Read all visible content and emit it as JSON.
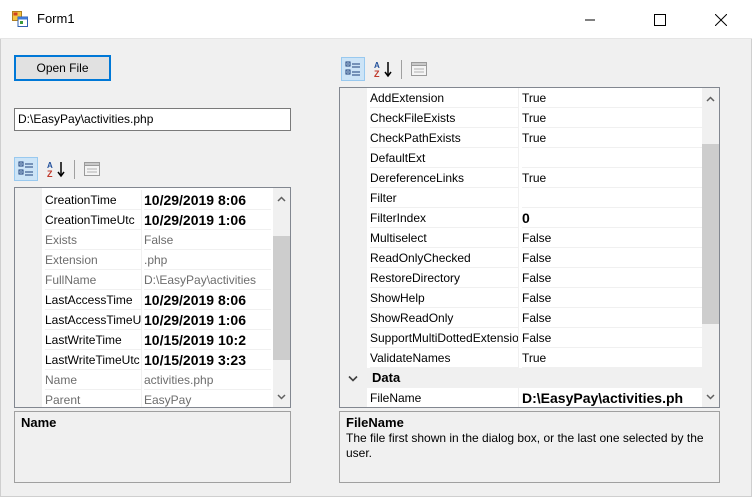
{
  "window": {
    "title": "Form1"
  },
  "open_button": {
    "label": "Open File"
  },
  "path_input": {
    "value": "D:\\EasyPay\\activities.php"
  },
  "left_grid": {
    "rows": [
      {
        "name": "CreationTime",
        "value": "10/29/2019 8:06",
        "style": "bigbold"
      },
      {
        "name": "CreationTimeUtc",
        "value": "10/29/2019 1:06",
        "style": "bigbold"
      },
      {
        "name": "Exists",
        "value": "False",
        "style": "ro"
      },
      {
        "name": "Extension",
        "value": ".php",
        "style": "ro"
      },
      {
        "name": "FullName",
        "value": "D:\\EasyPay\\activities",
        "style": "ro"
      },
      {
        "name": "LastAccessTime",
        "value": "10/29/2019 8:06",
        "style": "bigbold"
      },
      {
        "name": "LastAccessTimeUtc",
        "value": "10/29/2019 1:06",
        "style": "bigbold"
      },
      {
        "name": "LastWriteTime",
        "value": "10/15/2019 10:2",
        "style": "bigbold"
      },
      {
        "name": "LastWriteTimeUtc",
        "value": "10/15/2019 3:23",
        "style": "bigbold"
      },
      {
        "name": "Name",
        "value": "activities.php",
        "style": "ro"
      },
      {
        "name": "Parent",
        "value": "EasyPay",
        "style": "ro"
      }
    ],
    "help_title": "Name",
    "help_desc": ""
  },
  "right_grid": {
    "rows": [
      {
        "name": "AddExtension",
        "value": "True",
        "style": ""
      },
      {
        "name": "CheckFileExists",
        "value": "True",
        "style": ""
      },
      {
        "name": "CheckPathExists",
        "value": "True",
        "style": ""
      },
      {
        "name": "DefaultExt",
        "value": "",
        "style": ""
      },
      {
        "name": "DereferenceLinks",
        "value": "True",
        "style": ""
      },
      {
        "name": "Filter",
        "value": "",
        "style": ""
      },
      {
        "name": "FilterIndex",
        "value": "0",
        "style": "bigbold"
      },
      {
        "name": "Multiselect",
        "value": "False",
        "style": ""
      },
      {
        "name": "ReadOnlyChecked",
        "value": "False",
        "style": ""
      },
      {
        "name": "RestoreDirectory",
        "value": "False",
        "style": ""
      },
      {
        "name": "ShowHelp",
        "value": "False",
        "style": ""
      },
      {
        "name": "ShowReadOnly",
        "value": "False",
        "style": ""
      },
      {
        "name": "SupportMultiDottedExtensions",
        "value": "False",
        "style": ""
      },
      {
        "name": "ValidateNames",
        "value": "True",
        "style": ""
      }
    ],
    "category": "Data",
    "after_category": [
      {
        "name": "FileName",
        "value": "D:\\EasyPay\\activities.ph",
        "style": "bigbold"
      }
    ],
    "help_title": "FileName",
    "help_desc": "The file first shown in the dialog box, or the last one selected by the user."
  }
}
